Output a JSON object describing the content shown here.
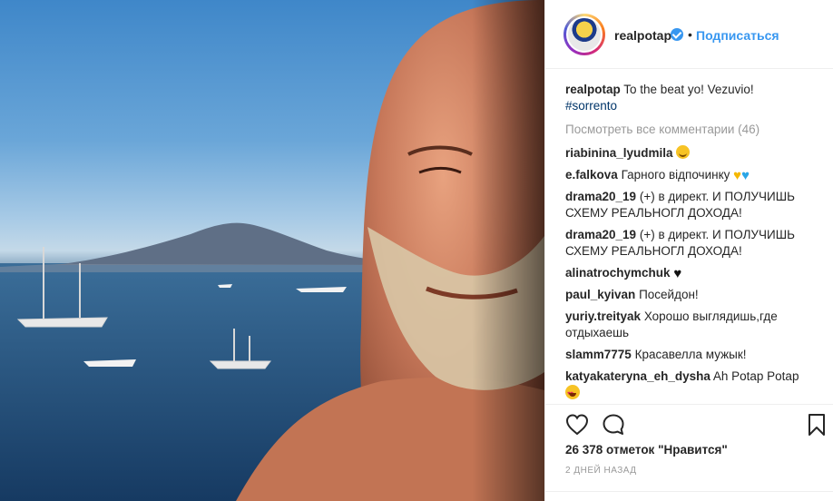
{
  "post": {
    "username": "realpotap",
    "separator": "•",
    "follow_label": "Подписаться"
  },
  "caption": {
    "username": "realpotap",
    "text": "To the beat yo! Vezuvio!",
    "hashtag": "#sorrento"
  },
  "view_all": "Посмотреть все комментарии (46)",
  "comments": [
    {
      "user": "riabinina_lyudmila",
      "text": "",
      "emoji": "smiling-face-emoji"
    },
    {
      "user": "e.falkova",
      "text": "Гарного відпочинку",
      "emoji": "yellow-blue-hearts"
    },
    {
      "user": "drama20_19",
      "text": "(+) в директ. И ПОЛУЧИШЬ",
      "text2": "СХЕМУ РЕАЛЬНОГЛ ДОХОДА!"
    },
    {
      "user": "drama20_19",
      "text": "(+) в директ. И ПОЛУЧИШЬ",
      "text2": "СХЕМУ РЕАЛЬНОГЛ ДОХОДА!"
    },
    {
      "user": "alinatrochymchuk",
      "text": "",
      "emoji": "black-heart"
    },
    {
      "user": "paul_kyivan",
      "text": "Посейдон!"
    },
    {
      "user": "yuriy.treityak",
      "text": "Хорошо выглядишь,где",
      "text2": "отдыхаешь"
    },
    {
      "user": "slamm7775",
      "text": "Красавелла мужык!"
    },
    {
      "user": "katyakateryna_eh_dysha",
      "text": "Ah Potap Potap",
      "emoji": "heart-eyes-emoji"
    }
  ],
  "icons": {
    "like": "heart-outline-icon",
    "comment": "speech-bubble-icon",
    "save": "bookmark-icon",
    "verified": "verified-badge-icon"
  },
  "likes": "26 378 отметок \"Нравится\"",
  "time_ago": "2 ДНЕЙ НАЗАД",
  "colors": {
    "link": "#3897f0",
    "hashtag": "#003569",
    "muted": "#999999"
  }
}
